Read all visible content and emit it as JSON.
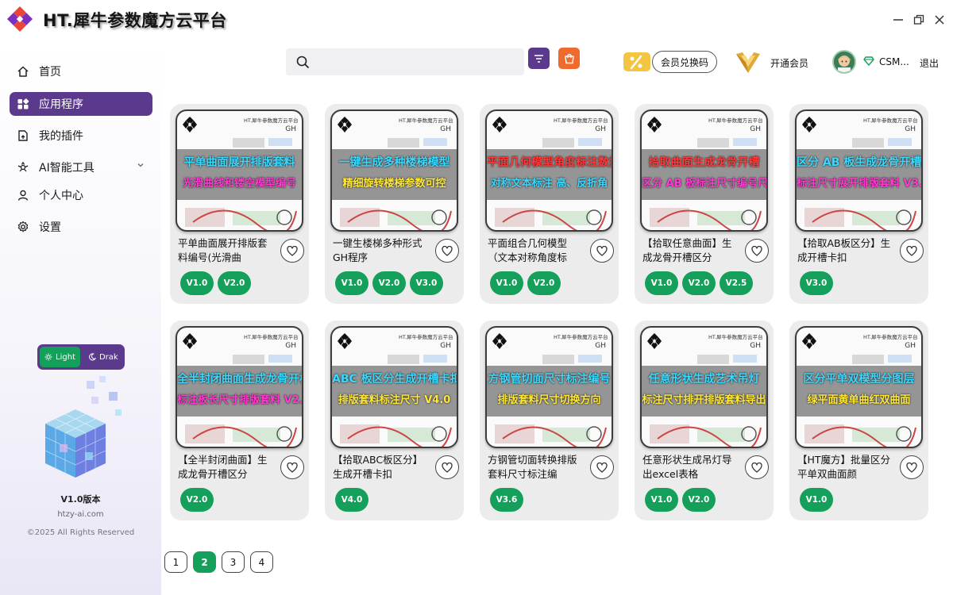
{
  "app": {
    "title": "HT.犀牛参数魔方云平台"
  },
  "window": {
    "minimize_icon": "minimize-icon",
    "maximize_icon": "restore-icon",
    "close_icon": "close-icon"
  },
  "sidebar": {
    "items": [
      {
        "label": "首页",
        "icon": "home-icon",
        "active": false
      },
      {
        "label": "应用程序",
        "icon": "apps-icon",
        "active": true
      },
      {
        "label": "我的插件",
        "icon": "plugin-icon",
        "active": false
      },
      {
        "label": "AI智能工具",
        "icon": "ai-icon",
        "active": false
      },
      {
        "label": "个人中心",
        "icon": "user-icon",
        "active": false
      },
      {
        "label": "设置",
        "icon": "gear-icon",
        "active": false
      }
    ],
    "theme": {
      "light_label": "Light",
      "dark_label": "Drak"
    },
    "version": "V1.0版本",
    "site": "htzy-ai.com",
    "copyright": "©2025 All Rights Reserved"
  },
  "topbar": {
    "search_placeholder": "",
    "redeem_label": "会员兑换码",
    "vip_label": "开通会员",
    "username": "CSM...",
    "logout_label": "退出"
  },
  "thumb_common": {
    "brand": "HT.犀牛参数魔方云平台",
    "gh": "GH"
  },
  "cards": [
    {
      "title": "平单曲面展开排版套料编号(光滑曲",
      "line1": "平单曲面展开排版套料",
      "line2": "光滑曲线和镂空模型编号",
      "c1": "#3ad9ff",
      "c2": "#ff3ad0",
      "versions": [
        "V1.0",
        "V2.0"
      ]
    },
    {
      "title": "一键生楼梯多种形式GH程序",
      "line1": "一键生成多种楼梯模型",
      "line2": "精细旋转楼梯参数可控",
      "c1": "#3ad9ff",
      "c2": "#ffe83a",
      "versions": [
        "V1.0",
        "V2.0",
        "V3.0"
      ]
    },
    {
      "title": "平面组合几何模型（文本对称角度标",
      "line1": "平面几何模型角度标注数据",
      "line2": "对称文本标注 高、反折角",
      "c1": "#ff3a3a",
      "c2": "#3ad9ff",
      "versions": [
        "V1.0",
        "V2.0"
      ]
    },
    {
      "title": "【拾取任意曲面】生成龙骨开槽区分",
      "line1": "拾取曲面生成龙骨开槽",
      "line2": "区分 AB 板标注尺寸编号尺寸 V1.0",
      "c1": "#ff3a3a",
      "c2": "#ff3ad0",
      "versions": [
        "V1.0",
        "V2.0",
        "V2.5"
      ]
    },
    {
      "title": "【拾取AB板区分】生成开槽卡扣",
      "line1": "区分 AB 板生成龙骨开槽",
      "line2": "标注尺寸展开排版套料 V3.0",
      "c1": "#3ad9ff",
      "c2": "#ff3ad0",
      "versions": [
        "V3.0"
      ]
    },
    {
      "title": "【全半封闭曲面】生成龙骨开槽区分",
      "line1": "全半封闭曲面生成龙骨开槽",
      "line2": "标注板长尺寸排版套料 V2.0",
      "c1": "#3ad9ff",
      "c2": "#ff3ad0",
      "versions": [
        "V2.0"
      ]
    },
    {
      "title": "【拾取ABC板区分】生成开槽卡扣",
      "line1": "ABC 板区分生成开槽卡扣",
      "line2": "排版套料标注尺寸 V4.0",
      "c1": "#3ad9ff",
      "c2": "#ffe83a",
      "versions": [
        "V4.0"
      ]
    },
    {
      "title": "方钢管切面转换排版套料尺寸标注编",
      "line1": "方钢管切面尺寸标注编号",
      "line2": "排版套料尺寸切换方向",
      "c1": "#3ad9ff",
      "c2": "#ffe83a",
      "versions": [
        "V3.6"
      ]
    },
    {
      "title": "任意形状生成吊灯导出excel表格",
      "line1": "任意形状生成艺术吊灯",
      "line2": "标注尺寸排开排版套料导出",
      "c1": "#3ad9ff",
      "c2": "#ffe83a",
      "versions": [
        "V1.0",
        "V2.0"
      ]
    },
    {
      "title": "【HT魔方】批量区分平单双曲面颜",
      "line1": "区分平单双模型分图层",
      "line2": "绿平面黄单曲红双曲面",
      "c1": "#3ad9ff",
      "c2": "#ffe83a",
      "versions": [
        "V1.0"
      ]
    }
  ],
  "pagination": {
    "pages": [
      "1",
      "2",
      "3",
      "4"
    ],
    "current": "2"
  }
}
